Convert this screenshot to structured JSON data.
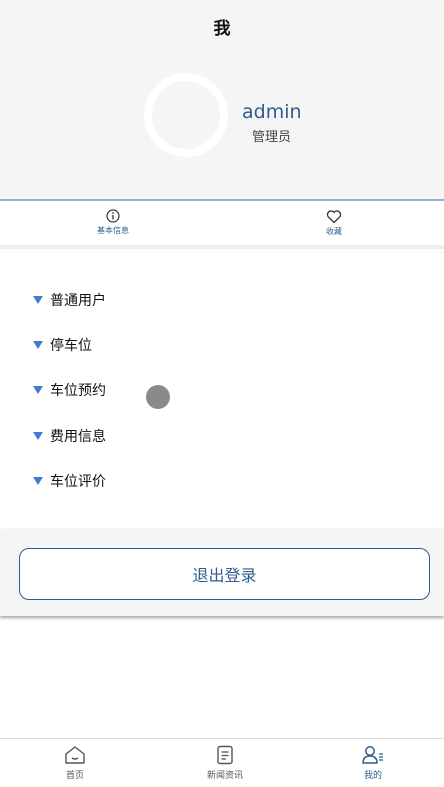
{
  "header": {
    "title": "我",
    "user_name": "admin",
    "user_role": "管理员"
  },
  "info_tabs": {
    "basic_info": "基本信息",
    "favorites": "收藏"
  },
  "menu": {
    "items": [
      "普通用户",
      "停车位",
      "车位预约",
      "费用信息",
      "车位评价"
    ]
  },
  "logout_label": "退出登录",
  "tabbar": {
    "home": "首页",
    "news": "新闻资讯",
    "mine": "我的"
  },
  "colors": {
    "accent": "#2f5d8c",
    "menu_triangle": "#3f7bd0",
    "header_bg": "#f5f5f5"
  }
}
